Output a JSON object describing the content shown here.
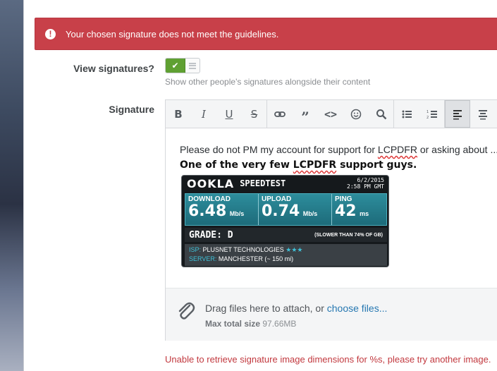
{
  "alert": {
    "icon": "exclamation-icon",
    "message": "Your chosen signature does not meet the guidelines."
  },
  "view_signatures": {
    "label": "View signatures?",
    "toggle_on": true,
    "hint": "Show other people's signatures alongside their content"
  },
  "signature": {
    "label": "Signature",
    "toolbar": [
      "bold-icon",
      "italic-icon",
      "underline-icon",
      "strikethrough-icon",
      "link-icon",
      "quote-icon",
      "code-icon",
      "smilie-icon",
      "search-icon",
      "bulleted-list-icon",
      "numbered-list-icon",
      "align-left-icon",
      "align-center-icon"
    ],
    "line1_pre": "Please do not PM my account for support for ",
    "line1_word": "LCPDFR",
    "line1_post": " or asking about ...",
    "line2_pre": "One of the very few ",
    "line2_word": "LCPDFR",
    "line2_post": " support guys."
  },
  "speedtest": {
    "logo": "OOKLA",
    "title": "SPEEDTEST",
    "date": "6/2/2015",
    "time": "2:58 PM GMT",
    "download_label": "DOWNLOAD",
    "download_value": "6.48",
    "download_unit": "Mb/s",
    "upload_label": "UPLOAD",
    "upload_value": "0.74",
    "upload_unit": "Mb/s",
    "ping_label": "PING",
    "ping_value": "42",
    "ping_unit": "ms",
    "grade": "GRADE: D",
    "grade_note": "(SLOWER THAN 74% OF GB)",
    "isp_label": "ISP:",
    "isp_value": "PLUSNET TECHNOLOGIES",
    "server_label": "SERVER:",
    "server_value": "MANCHESTER (~ 150 mi)"
  },
  "dropzone": {
    "icon": "paperclip-icon",
    "text": "Drag files here to attach, or ",
    "link": "choose files...",
    "size_label": "Max total size",
    "size_value": "97.66MB"
  },
  "error": "Unable to retrieve signature image dimensions for %s, please try another image.",
  "colors": {
    "alert": "#c84049",
    "toggle": "#5fa032",
    "link": "#2577b1",
    "error": "#c2393f"
  }
}
